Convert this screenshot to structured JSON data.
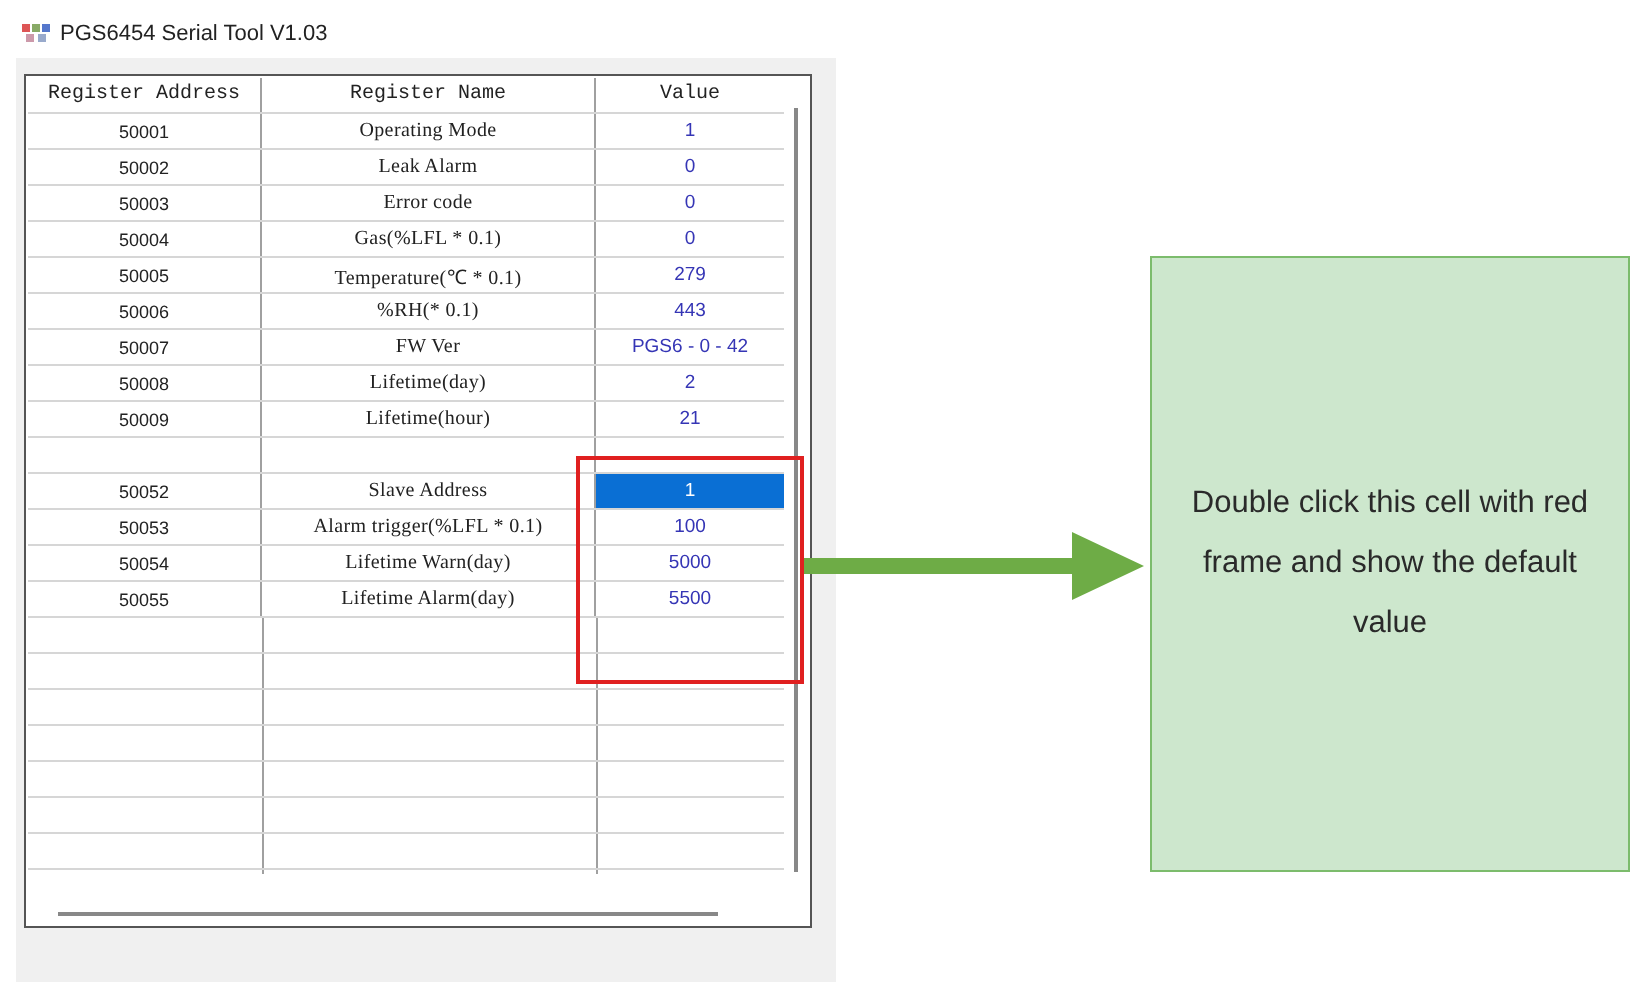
{
  "window": {
    "title": "PGS6454 Serial Tool V1.03"
  },
  "table": {
    "columns": [
      "Register Address",
      "Register Name",
      "Value"
    ],
    "row_groups": [
      [
        {
          "address": "50001",
          "name": "Operating Mode",
          "value": "1",
          "selected": false
        },
        {
          "address": "50002",
          "name": "Leak Alarm",
          "value": "0",
          "selected": false
        },
        {
          "address": "50003",
          "name": "Error code",
          "value": "0",
          "selected": false
        },
        {
          "address": "50004",
          "name": "Gas(%LFL * 0.1)",
          "value": "0",
          "selected": false
        },
        {
          "address": "50005",
          "name": "Temperature(℃ * 0.1)",
          "value": "279",
          "selected": false
        },
        {
          "address": "50006",
          "name": "%RH(* 0.1)",
          "value": "443",
          "selected": false
        },
        {
          "address": "50007",
          "name": "FW Ver",
          "value": "PGS6 - 0 - 42",
          "selected": false
        },
        {
          "address": "50008",
          "name": "Lifetime(day)",
          "value": "2",
          "selected": false
        },
        {
          "address": "50009",
          "name": "Lifetime(hour)",
          "value": "21",
          "selected": false
        }
      ],
      [
        {
          "address": "50052",
          "name": "Slave Address",
          "value": "1",
          "selected": true
        },
        {
          "address": "50053",
          "name": "Alarm trigger(%LFL * 0.1)",
          "value": "100",
          "selected": false
        },
        {
          "address": "50054",
          "name": "Lifetime Warn(day)",
          "value": "5000",
          "selected": false
        },
        {
          "address": "50055",
          "name": "Lifetime Alarm(day)",
          "value": "5500",
          "selected": false
        }
      ]
    ]
  },
  "callout": {
    "text": "Double click this cell with red frame and show the default value"
  }
}
